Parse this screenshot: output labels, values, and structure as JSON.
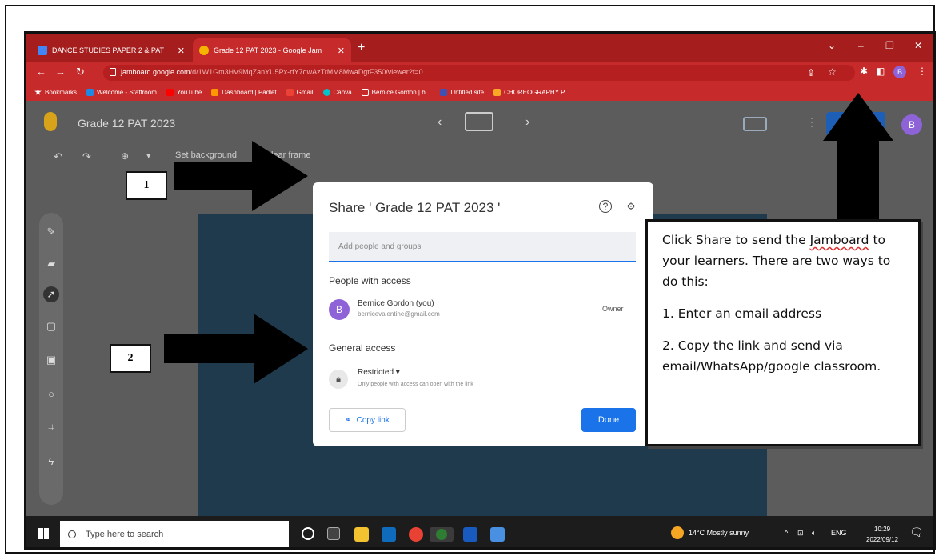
{
  "browser": {
    "tabs": [
      {
        "title": "DANCE STUDIES PAPER 2 & PAT",
        "active": false,
        "icon": "docs-icon"
      },
      {
        "title": "Grade 12 PAT 2023 - Google Jam",
        "active": true,
        "icon": "jamboard-icon"
      }
    ],
    "url_host": "jamboard.google.com",
    "url_path": "/d/1W1Gm3HV9MqZanYU5Px-rfY7dwAzTrMM8MwaDgtF350/viewer?f=0",
    "bookmarks": [
      {
        "label": "Bookmarks",
        "icon": "star-icon",
        "color": "#ffffff"
      },
      {
        "label": "Welcome - Staffroom",
        "icon": "sharepoint-icon",
        "color": "#1e88e5"
      },
      {
        "label": "YouTube",
        "icon": "youtube-icon",
        "color": "#ff0000"
      },
      {
        "label": "Dashboard | Padlet",
        "icon": "padlet-icon",
        "color": "#ff9800"
      },
      {
        "label": "Gmail",
        "icon": "gmail-icon",
        "color": "#ea4335"
      },
      {
        "label": "Canva",
        "icon": "canva-icon",
        "color": "#00c4cc"
      },
      {
        "label": "Bernice Gordon | b...",
        "icon": "bernice-icon",
        "color": "#ffffff"
      },
      {
        "label": "Untitled site",
        "icon": "sites-icon",
        "color": "#3f51b5"
      },
      {
        "label": "CHOREOGRAPHY P...",
        "icon": "choreo-icon",
        "color": "#f9a825"
      }
    ],
    "profile_initial": "B"
  },
  "app": {
    "title": "Grade 12 PAT 2023",
    "toolbar": {
      "set_background": "Set background",
      "clear_frame": "Clear frame"
    },
    "account_initial": "B"
  },
  "dialog": {
    "title": "Share ' Grade 12 PAT 2023 '",
    "add_placeholder": "Add people and groups",
    "people_heading": "People with access",
    "user": {
      "initial": "B",
      "name": "Bernice Gordon (you)",
      "email": "bernicevalentine@gmail.com",
      "role": "Owner"
    },
    "general_heading": "General access",
    "access_level": "Restricted",
    "access_desc": "Only people with access can open with the link",
    "copy_link": "Copy link",
    "done": "Done"
  },
  "annotations": {
    "label_1": "1",
    "label_2": "2",
    "callout_line1_a": "Click Share to send the ",
    "callout_line1_jam": "Jamboard",
    "callout_line1_b": " to your learners. There are two ways to do this:",
    "callout_step1": "1. Enter an email address",
    "callout_step2": "2. Copy the link and send via email/WhatsApp/google classroom."
  },
  "taskbar": {
    "search_placeholder": "Type here to search",
    "weather": "14°C Mostly sunny",
    "lang": "ENG",
    "time": "10:29",
    "date": "2022/09/12"
  }
}
